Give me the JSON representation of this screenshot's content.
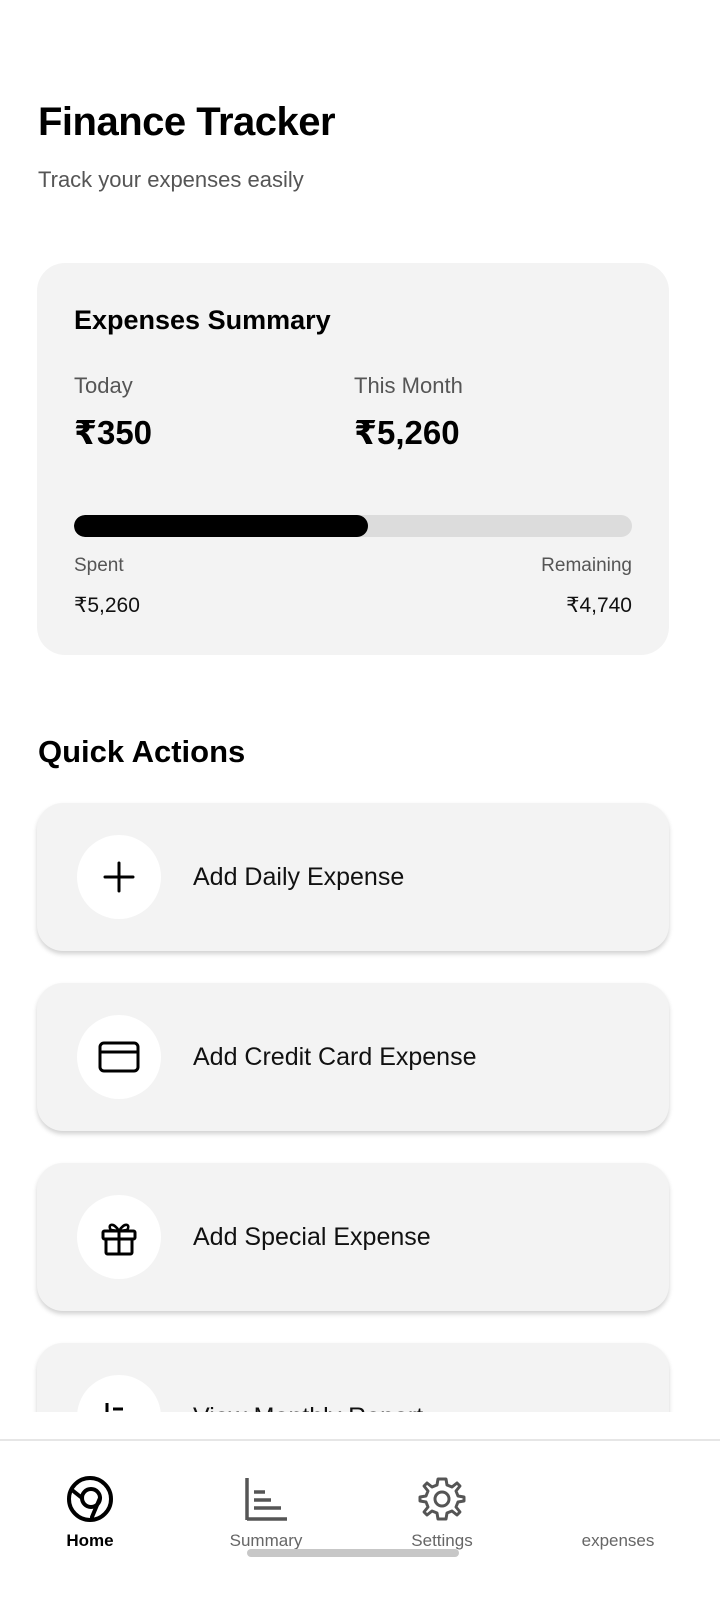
{
  "header": {
    "title": "Finance Tracker",
    "subtitle": "Track your expenses easily"
  },
  "summary": {
    "title": "Expenses Summary",
    "today_label": "Today",
    "today_value": "₹350",
    "month_label": "This Month",
    "month_value": "₹5,260",
    "progress_fraction": 0.526,
    "spent_label": "Spent",
    "spent_value": "₹5,260",
    "remaining_label": "Remaining",
    "remaining_value": "₹4,740"
  },
  "quick_actions": {
    "title": "Quick Actions",
    "items": [
      {
        "label": "Add Daily Expense",
        "icon": "plus-icon"
      },
      {
        "label": "Add Credit Card Expense",
        "icon": "credit-card-icon"
      },
      {
        "label": "Add Special Expense",
        "icon": "gift-icon"
      },
      {
        "label": "View Monthly Report",
        "icon": "report-icon"
      }
    ]
  },
  "bottom_nav": {
    "items": [
      {
        "label": "Home",
        "icon": "home-icon",
        "active": true
      },
      {
        "label": "Summary",
        "icon": "bar-chart-icon",
        "active": false
      },
      {
        "label": "Settings",
        "icon": "gear-icon",
        "active": false
      },
      {
        "label": "expenses",
        "icon": "",
        "active": false
      }
    ]
  },
  "colors": {
    "card_background": "#f3f3f3",
    "progress_fill": "#000000",
    "progress_track": "#dcdcdc",
    "secondary_text": "#555555"
  }
}
